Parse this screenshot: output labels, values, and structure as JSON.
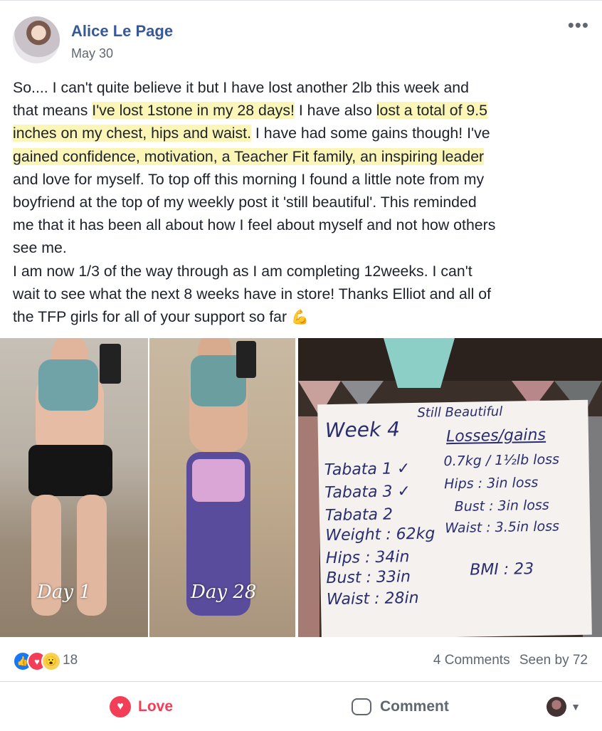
{
  "post": {
    "author": "Alice Le Page",
    "date": "May 30",
    "more_label": "•••",
    "text": {
      "l1": "So.... I can't quite believe it but I have lost another 2lb this week and",
      "l2a": "that means ",
      "l2b": "I've lost 1stone in my 28 days!",
      "l2c": " I have also ",
      "l2d": "lost a total of 9.5",
      "l3a": "inches on my chest, hips and waist.",
      "l3b": " I have had some gains though! I've",
      "l4": "gained confidence, motivation, a Teacher Fit family, an inspiring leader",
      "l5": "and love for myself. To top off this morning I found a little note from my",
      "l6": "boyfriend at the top of my weekly post it 'still beautiful'. This reminded",
      "l7": "me that it has been all about how I feel about myself and not how others",
      "l8": "see me.",
      "l9": "I am now 1/3 of the way through as I am completing 12weeks. I can't",
      "l10": "wait to see what the next 8 weeks have in store! Thanks Elliot and all of",
      "l11": "the TFP girls for all of your support so far",
      "emoji": "💪"
    },
    "photos": {
      "day1": "Day 1",
      "day28": "Day 28",
      "note": {
        "title": "Week 4",
        "subtitle": "Still Beautiful",
        "heading": "Losses/gains",
        "left": [
          "Tabata 1 ✓",
          "Tabata 3 ✓",
          "Tabata 2",
          "Weight : 62kg",
          "Hips : 34in",
          "Bust : 33in",
          "Waist : 28in"
        ],
        "right": [
          "0.7kg / 1½lb loss",
          "Hips : 3in loss",
          "Bust : 3in loss",
          "Waist : 3.5in loss",
          "BMI : 23"
        ]
      }
    },
    "reactions": {
      "count": "18",
      "comments": "4 Comments",
      "seen": "Seen by 72"
    },
    "actions": {
      "love": "Love",
      "comment": "Comment"
    }
  },
  "colors": {
    "link": "#385898",
    "highlight": "#fbf6b8",
    "love": "#f33e58",
    "like": "#1877f2"
  }
}
